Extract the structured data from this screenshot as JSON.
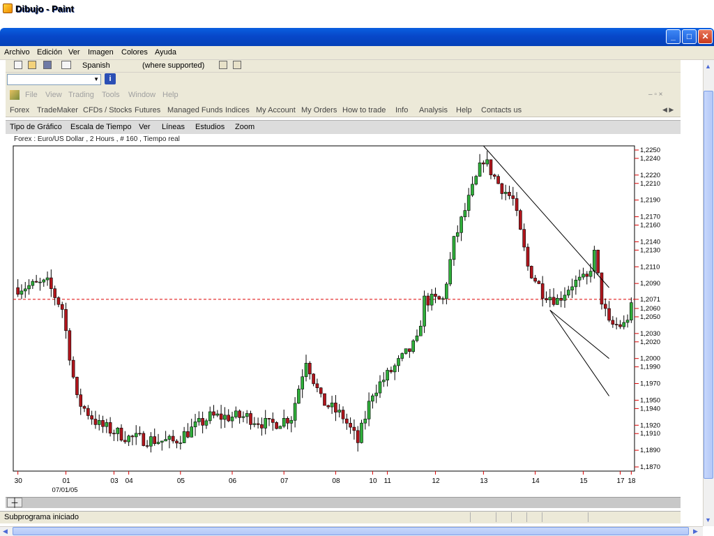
{
  "window": {
    "title": "Dibujo - Paint",
    "btn_min": "_",
    "btn_max": "□",
    "btn_close": "✕"
  },
  "menu": [
    "Archivo",
    "Edición",
    "Ver",
    "Imagen",
    "Colores",
    "Ayuda"
  ],
  "toolbar": {
    "language": "Spanish",
    "language_note": "(where supported)"
  },
  "info_button": "i",
  "app_menu": [
    "File",
    "View",
    "Trading",
    "Tools",
    "Window",
    "Help"
  ],
  "nav_tabs": [
    "Forex",
    "TradeMaker",
    "CFDs / Stocks",
    "Futures",
    "Managed Funds",
    "Indices",
    "My Account",
    "My Orders",
    "How to trade",
    "Info",
    "Analysis",
    "Help",
    "Contacts us"
  ],
  "chart_menu": [
    "Tipo de Gráfico",
    "Escala de Tiempo",
    "Ver",
    "Líneas",
    "Estudios",
    "Zoom"
  ],
  "chart_data": {
    "type": "candlestick",
    "title": "Forex : Euro/US Dollar , 2 Hours , # 160 , Tiempo real",
    "y_ticks": [
      "1,2250",
      "1,2240",
      "1,2220",
      "1,2210",
      "1,2190",
      "1,2170",
      "1,2160",
      "1,2140",
      "1,2130",
      "1,2110",
      "1,2090",
      "1,2071",
      "1,2060",
      "1,2050",
      "1,2030",
      "1,2020",
      "1,2000",
      "1,1990",
      "1,1970",
      "1,1950",
      "1,1940",
      "1,1920",
      "1,1910",
      "1,1890",
      "1,1870"
    ],
    "ylim": [
      1.1865,
      1.2255
    ],
    "current_price": "1,2071",
    "x_ticks": [
      "30",
      "01",
      "03",
      "04",
      "05",
      "06",
      "07",
      "08",
      "10",
      "11",
      "12",
      "13",
      "14",
      "15",
      "17",
      "18"
    ],
    "x_sublabel": "07/01/05",
    "trendlines": [
      {
        "from": [
          126,
          1.2255
        ],
        "to": [
          160,
          1.2085
        ]
      },
      {
        "from": [
          144,
          1.2058
        ],
        "to": [
          160,
          1.2
        ]
      },
      {
        "from": [
          144,
          1.2058
        ],
        "to": [
          160,
          1.1955
        ]
      }
    ]
  },
  "status": {
    "text": "Subprograma iniciado"
  }
}
